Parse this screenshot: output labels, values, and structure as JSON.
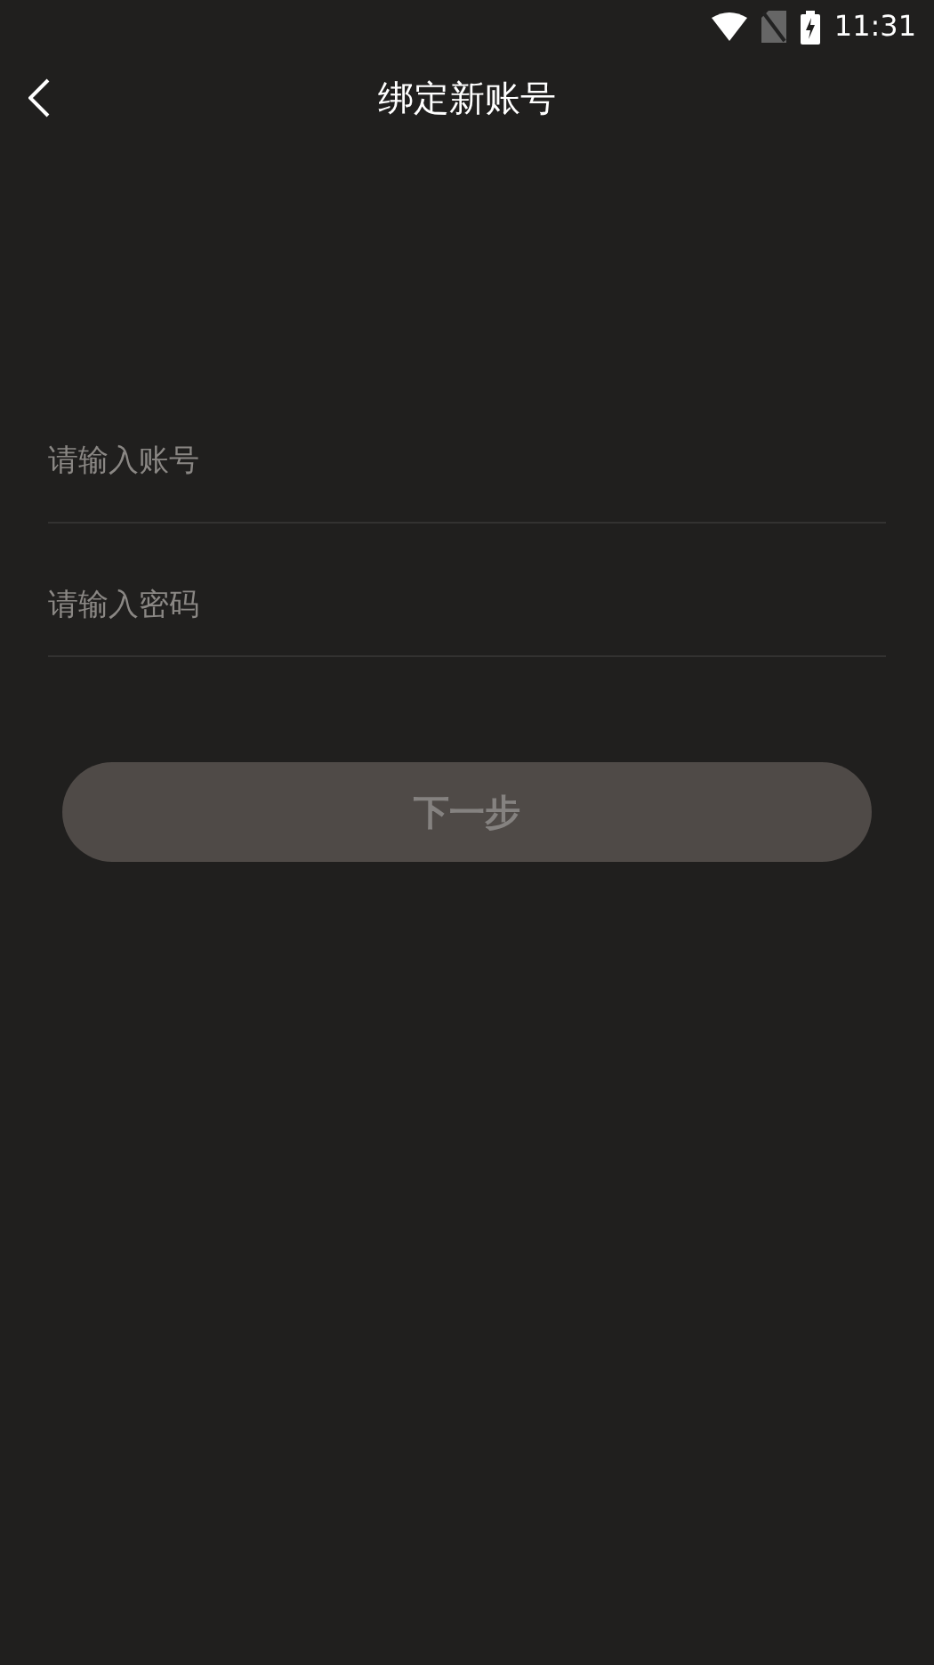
{
  "status_bar": {
    "time": "11:31"
  },
  "header": {
    "title": "绑定新账号"
  },
  "fields": [
    {
      "placeholder": "请输入账号"
    },
    {
      "placeholder": "请输入密码"
    }
  ],
  "next_button": {
    "label": "下一步",
    "disabled": true
  }
}
